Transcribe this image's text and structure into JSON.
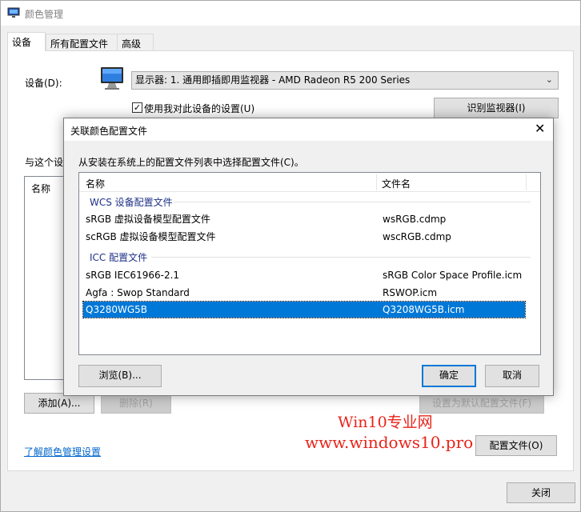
{
  "window": {
    "title": "颜色管理",
    "tabs": [
      "设备",
      "所有配置文件",
      "高级"
    ]
  },
  "device": {
    "label": "设备(D):",
    "select_value": "显示器: 1. 通用即插即用监视器 - AMD Radeon R5 200 Series",
    "checkbox_label": "使用我对此设备的设置(U)",
    "checkbox_checked": true,
    "identify_button": "识别监视器(I)",
    "assoc_label_partial": "与这个设",
    "list_header_partial": "名称"
  },
  "buttons": {
    "add": "添加(A)...",
    "remove": "删除(R)",
    "set_default": "设置为默认配置文件(F)",
    "profiles": "配置文件(O)",
    "close": "关闭"
  },
  "link": "了解颜色管理设置",
  "watermark": {
    "line1": "Win10专业网",
    "line2": "www.windows10.pro",
    "color": "#e8241a"
  },
  "dialog": {
    "title": "关联颜色配置文件",
    "instruction": "从安装在系统上的配置文件列表中选择配置文件(C)。",
    "columns": [
      "名称",
      "文件名"
    ],
    "groups": [
      {
        "name": "WCS 设备配置文件",
        "rows": [
          {
            "name": "sRGB 虚拟设备模型配置文件",
            "file": "wsRGB.cdmp"
          },
          {
            "name": "scRGB 虚拟设备模型配置文件",
            "file": "wscRGB.cdmp"
          }
        ]
      },
      {
        "name": "ICC 配置文件",
        "rows": [
          {
            "name": "sRGB IEC61966-2.1",
            "file": "sRGB Color Space Profile.icm"
          },
          {
            "name": "Agfa : Swop Standard",
            "file": "RSWOP.icm"
          },
          {
            "name": "Q3280WG5B",
            "file": "Q3208WG5B.icm",
            "selected": true
          }
        ]
      }
    ],
    "browse_button": "浏览(B)...",
    "ok_button": "确定",
    "cancel_button": "取消"
  },
  "colors": {
    "accent": "#0078d7",
    "link": "#0066cc",
    "group_text": "#1e3287"
  }
}
